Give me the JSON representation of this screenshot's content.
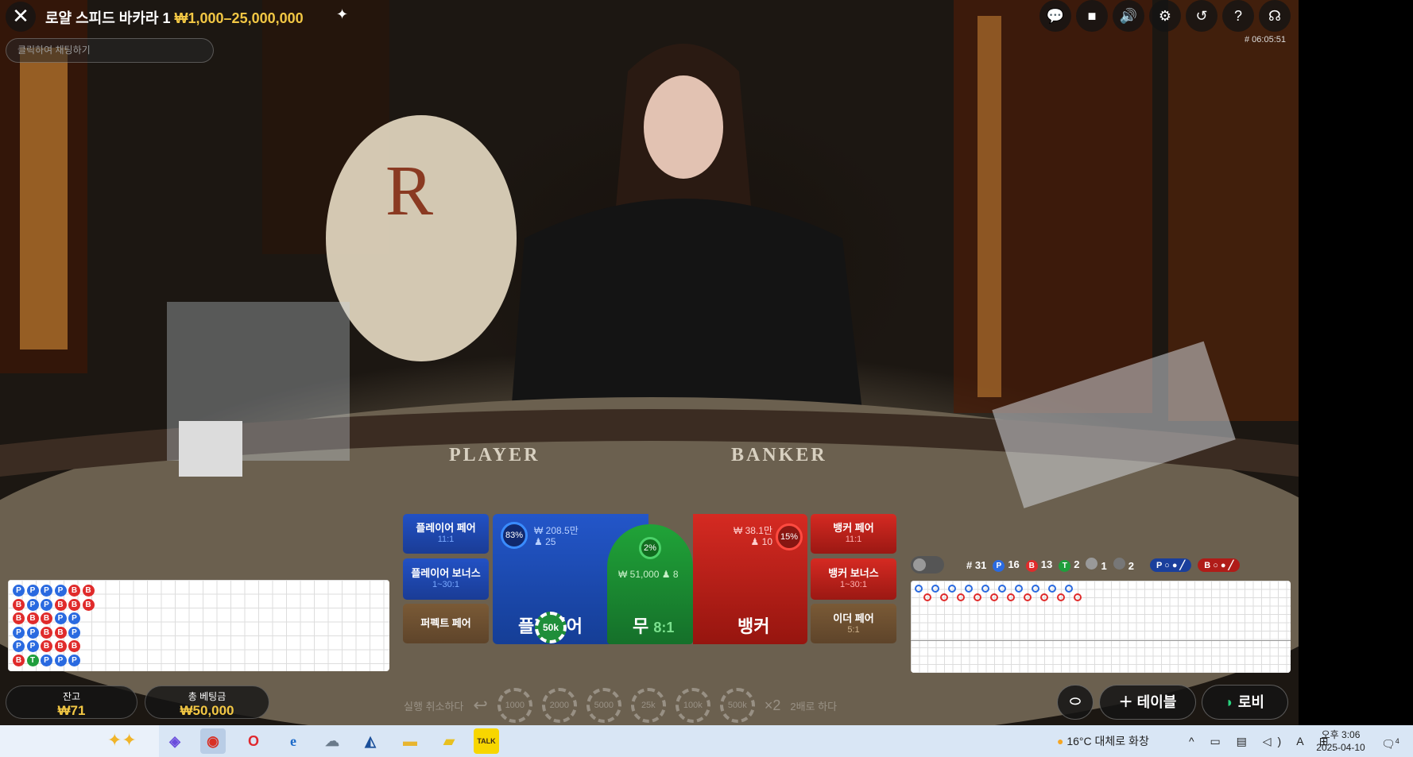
{
  "header": {
    "title": "로얄 스피드 바카라 1",
    "limits": "₩1,000–25,000,000",
    "chat_placeholder": "클릭하여 채팅하기",
    "game_id": "# 06:05:51"
  },
  "top_icons": [
    "chat-icon",
    "video-icon",
    "sound-icon",
    "gear-icon",
    "history-icon",
    "help-icon",
    "support-icon"
  ],
  "table_felt": {
    "player_text": "PLAYER",
    "banker_text": "BANKER"
  },
  "bets": {
    "player_pair": {
      "label": "플레이어 페어",
      "payout": "11:1"
    },
    "player_bonus": {
      "label": "플레이어 보너스",
      "payout": "1~30:1"
    },
    "perfect_pair": {
      "label": "퍼펙트 페어"
    },
    "banker_pair": {
      "label": "뱅커 페어",
      "payout": "11:1"
    },
    "banker_bonus": {
      "label": "뱅커 보너스",
      "payout": "1~30:1"
    },
    "either_pair": {
      "label": "이더 페어",
      "payout": "5:1"
    },
    "player": {
      "label": "플레이어",
      "pct": "83%",
      "amount": "₩ 208.5만",
      "players": "25"
    },
    "tie": {
      "label": "무",
      "payout": "8:1",
      "pct": "2%",
      "amount": "₩ 51,000",
      "players": "8"
    },
    "banker": {
      "label": "뱅커",
      "pct": "15%",
      "amount": "₩ 38.1만",
      "players": "10"
    },
    "placed_chip": "50k"
  },
  "stats": {
    "round": "# 31",
    "player": "16",
    "banker": "13",
    "tie": "2",
    "player_pair": "1",
    "banker_pair": "2",
    "p_predict": "P",
    "b_predict": "B"
  },
  "bead_road": [
    [
      "P",
      "B",
      "B",
      "P",
      "P",
      "B"
    ],
    [
      "P",
      "P",
      "B",
      "P",
      "P",
      "T"
    ],
    [
      "P",
      "P",
      "B",
      "B",
      "B",
      "P"
    ],
    [
      "P",
      "B",
      "P",
      "B",
      "B",
      "P"
    ],
    [
      "B",
      "B",
      "P",
      "P",
      "B",
      "P"
    ],
    [
      "B",
      "B",
      "",
      "",
      "",
      ""
    ]
  ],
  "big_road": [
    "P",
    "B",
    "P",
    "B",
    "P",
    "B",
    "P",
    "B",
    "P",
    "B",
    "P",
    "B",
    "P",
    "B",
    "P",
    "B",
    "P",
    "B",
    "P",
    "B"
  ],
  "balance": {
    "label": "잔고",
    "value": "₩71"
  },
  "total_bet": {
    "label": "총 베팅금",
    "value": "₩50,000"
  },
  "controls": {
    "undo": "실행 취소하다",
    "chips": [
      "1000",
      "2000",
      "5000",
      "25k",
      "100k",
      "500k"
    ],
    "double_x": "×2",
    "double": "2배로 하다"
  },
  "buttons": {
    "table": "테이블",
    "lobby": "로비"
  },
  "taskbar": {
    "weather": "16°C 대체로 화창",
    "time": "오후 3:06",
    "date": "2025-04-10",
    "notifications": "4",
    "kakao": "TALK"
  },
  "colors": {
    "player_blue": "#2251c4",
    "banker_red": "#d52a22",
    "tie_green": "#20a338",
    "gold": "#f2c744"
  }
}
